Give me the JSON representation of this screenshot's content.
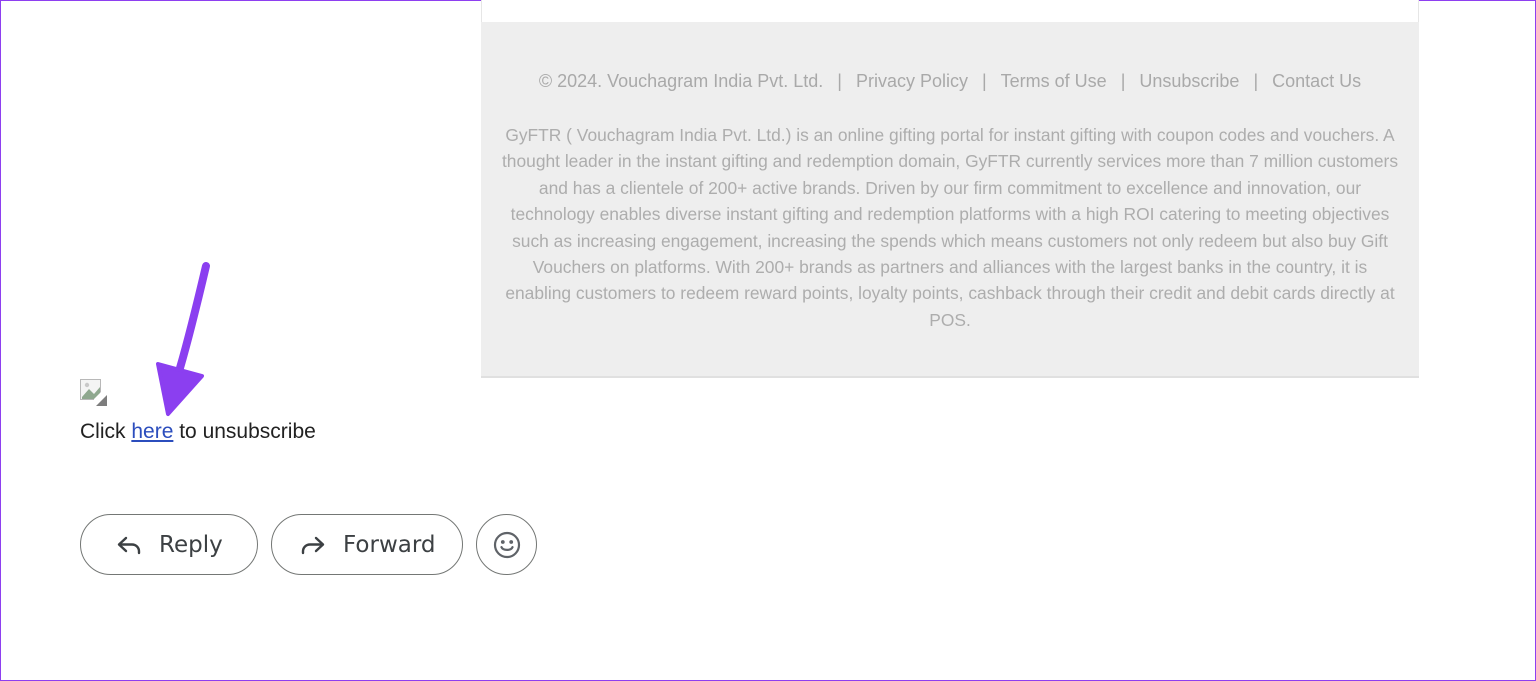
{
  "footer": {
    "copyright": "© 2024. Vouchagram India Pvt. Ltd.",
    "separator": "|",
    "links": {
      "privacy": "Privacy Policy",
      "terms": "Terms of Use",
      "unsubscribe": "Unsubscribe",
      "contact": "Contact Us"
    },
    "about": "GyFTR ( Vouchagram India Pvt. Ltd.) is an online gifting portal for instant gifting with coupon codes and vouchers. A thought leader in the instant gifting and redemption domain, GyFTR currently services more than 7 million customers and has a clientele of 200+ active brands. Driven by our firm commitment to excellence and innovation, our technology enables diverse instant gifting and redemption platforms with a high ROI catering to meeting objectives such as increasing engagement, increasing the spends which means customers not only redeem but also buy Gift Vouchers on platforms. With 200+ brands as partners and alliances with the largest banks in the country, it is enabling customers to redeem reward points, loyalty points, cashback through their credit and debit cards directly at POS."
  },
  "unsubscribe_line": {
    "prefix": "Click",
    "link_text": "here",
    "suffix": "to unsubscribe"
  },
  "actions": {
    "reply_label": "Reply",
    "forward_label": "Forward",
    "reply_icon": "reply-arrow-icon",
    "forward_icon": "forward-arrow-icon",
    "emoji_icon": "smiley-icon"
  },
  "colors": {
    "annotation_arrow": "#8b3ff0",
    "link": "#2b4dbd",
    "footer_bg": "#eeeeee",
    "footer_text": "#a9a9a9"
  }
}
